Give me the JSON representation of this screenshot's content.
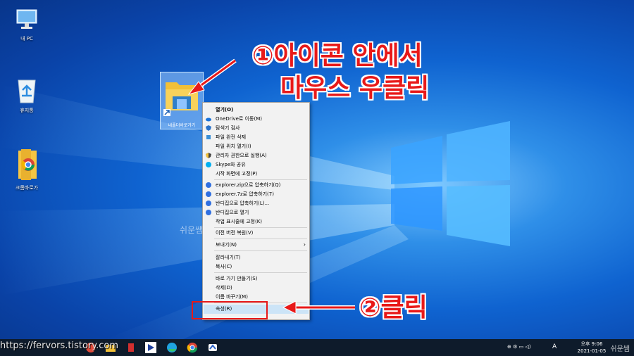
{
  "desktop": {
    "icons": [
      {
        "label": "내 PC"
      },
      {
        "label": "휴지통"
      },
      {
        "label": "크롬바로가"
      },
      {
        "label": "내폴더바로가기"
      }
    ]
  },
  "context_menu": {
    "items": [
      {
        "label": "열기(O)",
        "bold": true,
        "icon": ""
      },
      {
        "label": "OneDrive로 이동(M)",
        "icon": "onedrive-icon"
      },
      {
        "label": "탐색기 검사",
        "icon": "defender-icon"
      },
      {
        "label": "파일 완전 삭제",
        "icon": "shred-icon"
      },
      {
        "label": "파일 위치 열기(I)",
        "icon": ""
      },
      {
        "label": "관리자 권한으로 실행(A)",
        "icon": "shield-icon"
      },
      {
        "label": "Skype와 공유",
        "icon": "skype-icon"
      },
      {
        "label": "시작 화면에 고정(P)",
        "icon": ""
      },
      {
        "label": "explorer.zip으로 압축하기(Q)",
        "icon": "bandizip-icon"
      },
      {
        "label": "explorer.7z로 압축하기(7)",
        "icon": "bandizip-icon"
      },
      {
        "label": "반디집으로 압축하기(L)...",
        "icon": "bandizip-icon"
      },
      {
        "label": "반디집으로 열기",
        "icon": "bandizip-icon"
      },
      {
        "label": "작업 표시줄에 고정(K)",
        "icon": ""
      },
      {
        "label": "이전 버전 복원(V)",
        "icon": ""
      },
      {
        "label": "보내기(N)",
        "icon": "",
        "submenu": true
      },
      {
        "label": "잘라내기(T)",
        "icon": ""
      },
      {
        "label": "복사(C)",
        "icon": ""
      },
      {
        "label": "바로 가기 만들기(S)",
        "icon": ""
      },
      {
        "label": "삭제(D)",
        "icon": ""
      },
      {
        "label": "이름 바꾸기(M)",
        "icon": ""
      },
      {
        "label": "속성(R)",
        "icon": "",
        "highlight": true
      }
    ]
  },
  "annotations": {
    "step1_line1": "①아이콘 안에서",
    "step1_line2": "마우스 우클릭",
    "step2": "②클릭",
    "watermark": "쉬운쌤"
  },
  "taskbar": {
    "url_overlay": "https://fervors.tistory.com",
    "clock_time": "오후 9:06",
    "clock_date": "2021-01-05",
    "ime": "A",
    "corner_watermark": "쉬운쌤"
  },
  "colors": {
    "annotation_red": "#e81919",
    "menu_bg": "#f2f2f2",
    "highlight": "#cce4f7",
    "taskbar": "#0e1b2b"
  }
}
